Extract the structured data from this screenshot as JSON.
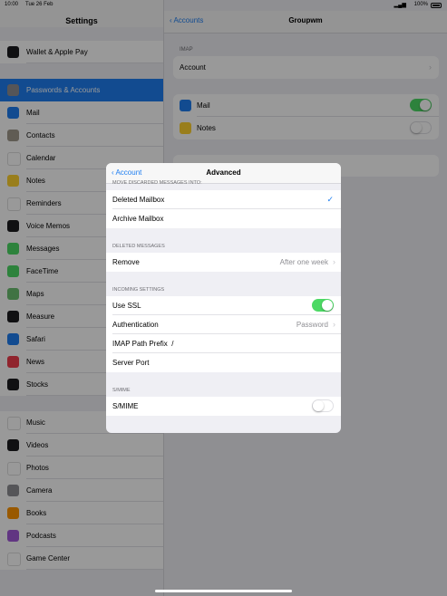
{
  "status": {
    "time": "10:00",
    "date": "Tue 26 Feb",
    "battery": "100%"
  },
  "sidebar": {
    "title": "Settings",
    "partial_top": "Wallet & Apple Pay",
    "items": [
      {
        "label": "Wallet & Apple Pay",
        "icon": "wallet-icon",
        "color": "#1c1c1e"
      },
      {
        "label": "Passwords & Accounts",
        "icon": "key-icon",
        "color": "#8e8e93",
        "active": true
      },
      {
        "label": "Mail",
        "icon": "mail-icon",
        "color": "#1e7ef1"
      },
      {
        "label": "Contacts",
        "icon": "contacts-icon",
        "color": "#a1998d"
      },
      {
        "label": "Calendar",
        "icon": "calendar-icon",
        "color": "#ffffff"
      },
      {
        "label": "Notes",
        "icon": "notes-icon",
        "color": "#ffd230"
      },
      {
        "label": "Reminders",
        "icon": "reminders-icon",
        "color": "#ffffff"
      },
      {
        "label": "Voice Memos",
        "icon": "voice-memos-icon",
        "color": "#1c1c1e"
      },
      {
        "label": "Messages",
        "icon": "messages-icon",
        "color": "#4cd964"
      },
      {
        "label": "FaceTime",
        "icon": "facetime-icon",
        "color": "#4cd964"
      },
      {
        "label": "Maps",
        "icon": "maps-icon",
        "color": "#6cc070"
      },
      {
        "label": "Measure",
        "icon": "measure-icon",
        "color": "#1c1c1e"
      },
      {
        "label": "Safari",
        "icon": "safari-icon",
        "color": "#1e7ef1"
      },
      {
        "label": "News",
        "icon": "news-icon",
        "color": "#f03c4c"
      },
      {
        "label": "Stocks",
        "icon": "stocks-icon",
        "color": "#1c1c1e"
      },
      {
        "label": "Music",
        "icon": "music-icon",
        "color": "#ffffff"
      },
      {
        "label": "Videos",
        "icon": "videos-icon",
        "color": "#1c1c1e"
      },
      {
        "label": "Photos",
        "icon": "photos-icon",
        "color": "#ffffff"
      },
      {
        "label": "Camera",
        "icon": "camera-icon",
        "color": "#8e8e93"
      },
      {
        "label": "Books",
        "icon": "books-icon",
        "color": "#ff9500"
      },
      {
        "label": "Podcasts",
        "icon": "podcasts-icon",
        "color": "#a259d9"
      },
      {
        "label": "Game Center",
        "icon": "game-center-icon",
        "color": "#ffffff"
      }
    ]
  },
  "detail": {
    "back": "Accounts",
    "title": "Groupwm",
    "imap_header": "IMAP",
    "account": "Account",
    "mail": "Mail",
    "notes": "Notes"
  },
  "modal": {
    "back": "Account",
    "title": "Advanced",
    "move_header": "MOVE DISCARDED MESSAGES INTO:",
    "deleted_mailbox": "Deleted Mailbox",
    "archive_mailbox": "Archive Mailbox",
    "deleted_header": "DELETED MESSAGES",
    "remove": "Remove",
    "remove_value": "After one week",
    "incoming_header": "INCOMING SETTINGS",
    "use_ssl": "Use SSL",
    "authentication": "Authentication",
    "authentication_value": "Password",
    "imap_path_prefix": "IMAP Path Prefix",
    "imap_path_prefix_value": "/",
    "server_port": "Server Port",
    "smime_header": "S/MIME",
    "smime": "S/MIME"
  },
  "colors": {
    "accent": "#1e7ef1",
    "toggle_on": "#4cd964"
  }
}
